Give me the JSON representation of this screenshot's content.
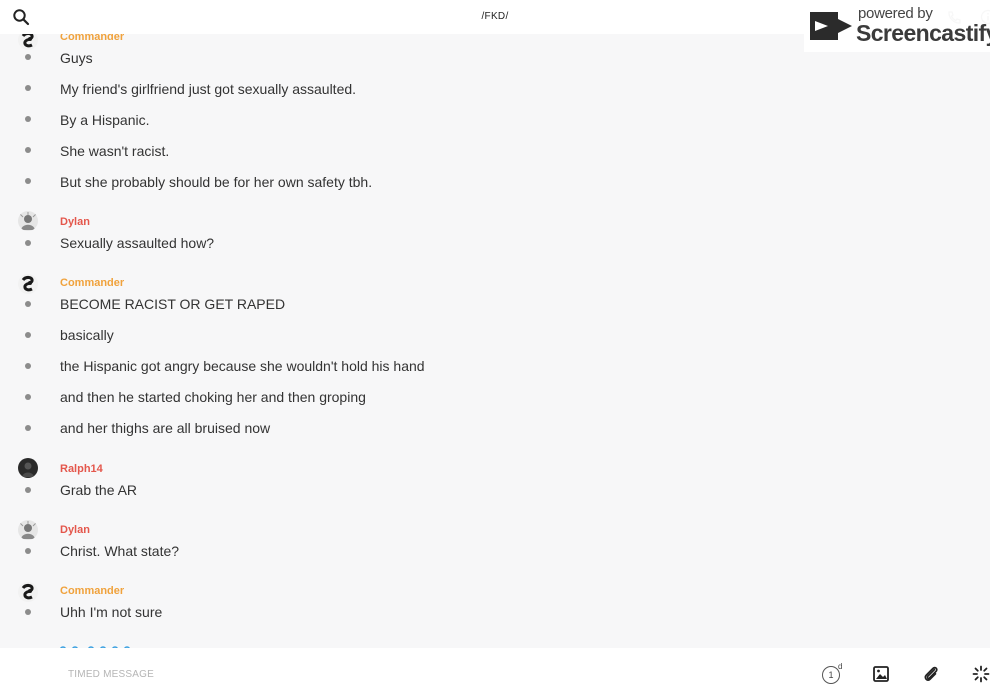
{
  "header": {
    "channel_title": "/FKD/",
    "search_icon": "search-icon",
    "call_icon": "phone-icon",
    "info_icon": "info-icon"
  },
  "watermark": {
    "powered_by": "powered by",
    "brand": "Screencastify"
  },
  "colors": {
    "commander": "#f0a23c",
    "dylan": "#e4574c",
    "ralph": "#e4574c",
    "bullet": "#8c8c8c"
  },
  "messages": [
    {
      "author": "Commander",
      "lines": [
        "Guys",
        "My friend's girlfriend just got sexually assaulted.",
        "By a Hispanic.",
        "She wasn't racist.",
        "But she probably should be for her own safety tbh."
      ]
    },
    {
      "author": "Dylan",
      "lines": [
        "Sexually assaulted how?"
      ]
    },
    {
      "author": "Commander",
      "lines": [
        "BECOME RACIST OR GET RAPED",
        "basically",
        "the Hispanic got angry because she wouldn't hold his hand",
        "and then he started choking her and then groping",
        "and her thighs are all bruised now"
      ]
    },
    {
      "author": "Ralph14",
      "lines": [
        "Grab the AR"
      ]
    },
    {
      "author": "Dylan",
      "lines": [
        "Christ. What state?"
      ]
    },
    {
      "author": "Commander",
      "lines": [
        "Uhh I'm not sure"
      ]
    }
  ],
  "composer": {
    "placeholder": "TIMED MESSAGE",
    "timer_value": "1",
    "timer_unit": "d",
    "image_icon": "image-icon",
    "attach_icon": "paperclip-icon",
    "sparkle_icon": "sparkle-icon"
  }
}
